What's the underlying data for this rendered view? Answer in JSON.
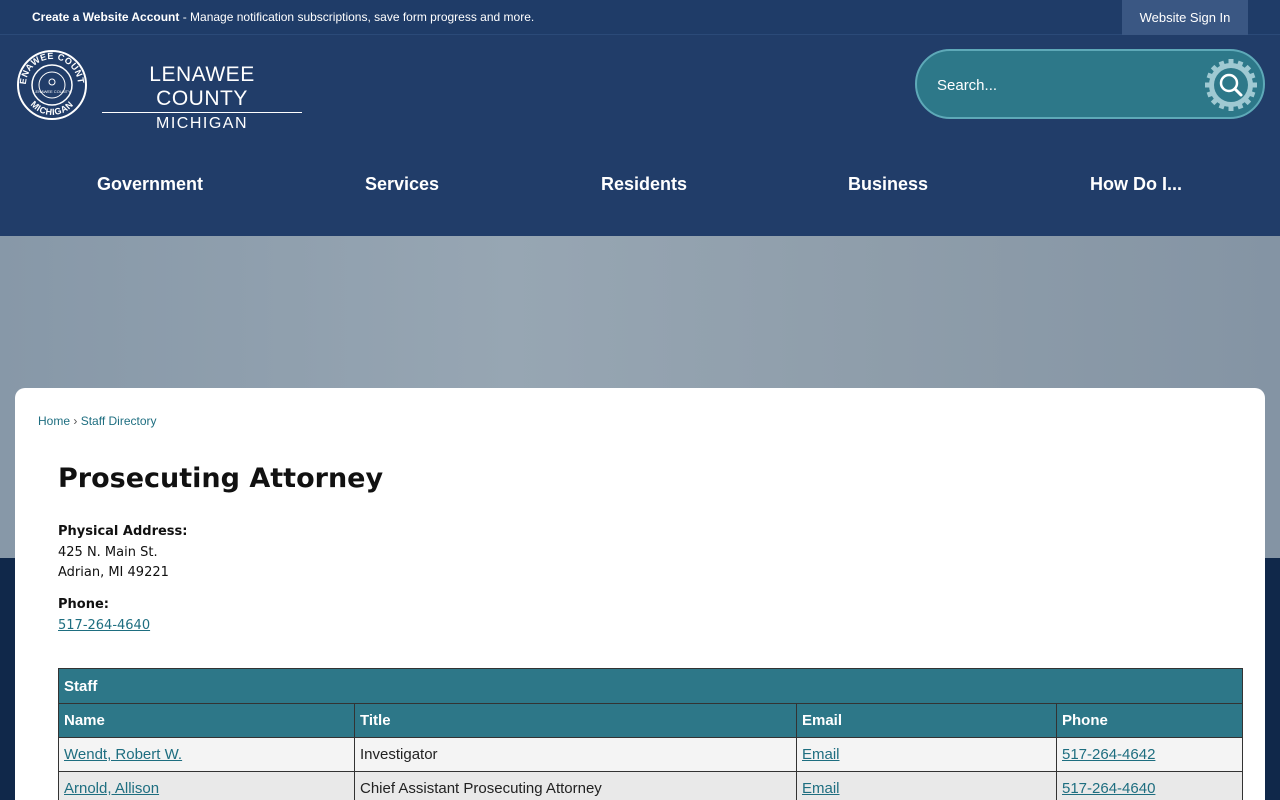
{
  "topbar": {
    "account_link": "Create a Website Account",
    "account_text": " - Manage notification subscriptions, save form progress and more.",
    "signin_label": "Website Sign In"
  },
  "logo": {
    "county": "LENAWEE COUNTY",
    "state": "MICHIGAN",
    "seal_top": "LENAWEE COUNTY",
    "seal_bottom": "MICHIGAN",
    "seal_center": "LENAWEE COUNTY"
  },
  "search": {
    "placeholder": "Search..."
  },
  "nav": {
    "items": [
      "Government",
      "Services",
      "Residents",
      "Business",
      "How Do I..."
    ]
  },
  "breadcrumb": {
    "home": "Home",
    "separator": "›",
    "current": "Staff Directory"
  },
  "department": {
    "title": "Prosecuting Attorney",
    "address_label": "Physical Address:",
    "address_line1": "425 N. Main St.",
    "address_line2": "Adrian, MI 49221",
    "phone_label": "Phone:",
    "phone": "517-264-4640"
  },
  "staff": {
    "caption": "Staff",
    "headers": [
      "Name",
      "Title",
      "Email",
      "Phone"
    ],
    "rows": [
      {
        "name": "Wendt, Robert W.",
        "title": "Investigator",
        "email": "Email",
        "phone": "517-264-4642"
      },
      {
        "name": "Arnold, Allison",
        "title": "Chief Assistant Prosecuting Attorney",
        "email": "Email",
        "phone": "517-264-4640"
      }
    ]
  },
  "colors": {
    "header_bg": "#213d69",
    "accent_teal": "#2d7788",
    "link": "#1e6e80"
  }
}
